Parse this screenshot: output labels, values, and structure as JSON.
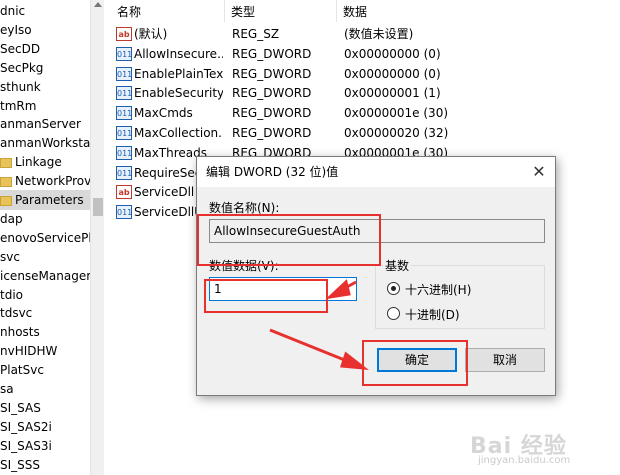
{
  "tree": {
    "items": [
      {
        "label": "dnic"
      },
      {
        "label": "eyIso"
      },
      {
        "label": "SecDD"
      },
      {
        "label": "SecPkg"
      },
      {
        "label": "sthunk"
      },
      {
        "label": "tmRm"
      },
      {
        "label": "anmanServer"
      },
      {
        "label": "anmanWorkstatio"
      },
      {
        "label": "Linkage"
      },
      {
        "label": "NetworkProvid"
      },
      {
        "label": "Parameters"
      },
      {
        "label": "dap"
      },
      {
        "label": "enovoServicePlug"
      },
      {
        "label": "svc"
      },
      {
        "label": "icenseManager"
      },
      {
        "label": "tdio"
      },
      {
        "label": "tdsvc"
      },
      {
        "label": "nhosts"
      },
      {
        "label": "nvHIDHW"
      },
      {
        "label": "PlatSvc"
      },
      {
        "label": "sa"
      },
      {
        "label": "SI_SAS"
      },
      {
        "label": "SI_SAS2i"
      },
      {
        "label": "SI_SAS3i"
      },
      {
        "label": "SI_SSS"
      }
    ]
  },
  "columns": {
    "name": "名称",
    "type": "类型",
    "data": "数据"
  },
  "rows": [
    {
      "icon": "ab",
      "name": "(默认)",
      "type": "REG_SZ",
      "data": "(数值未设置)"
    },
    {
      "icon": "dw",
      "name": "AllowInsecure...",
      "type": "REG_DWORD",
      "data": "0x00000000 (0)"
    },
    {
      "icon": "dw",
      "name": "EnablePlainTex...",
      "type": "REG_DWORD",
      "data": "0x00000000 (0)"
    },
    {
      "icon": "dw",
      "name": "EnableSecurity...",
      "type": "REG_DWORD",
      "data": "0x00000001 (1)"
    },
    {
      "icon": "dw",
      "name": "MaxCmds",
      "type": "REG_DWORD",
      "data": "0x0000001e (30)"
    },
    {
      "icon": "dw",
      "name": "MaxCollection...",
      "type": "REG_DWORD",
      "data": "0x00000020 (32)"
    },
    {
      "icon": "dw",
      "name": "MaxThreads",
      "type": "REG_DWORD",
      "data": "0x0000001e (30)"
    },
    {
      "icon": "dw",
      "name": "RequireSec",
      "type": "",
      "data": ""
    },
    {
      "icon": "ab",
      "name": "ServiceDll",
      "type": "",
      "data": ""
    },
    {
      "icon": "dw",
      "name": "ServiceDllU",
      "type": "",
      "data": ""
    }
  ],
  "dialog": {
    "title": "编辑 DWORD (32 位)值",
    "close_glyph": "✕",
    "name_label": "数值名称(N):",
    "name_value": "AllowInsecureGuestAuth",
    "data_label": "数值数据(V):",
    "data_value": "1",
    "base_label": "基数",
    "hex_label": "十六进制(H)",
    "dec_label": "十进制(D)",
    "hex_selected": true,
    "ok_label": "确定",
    "cancel_label": "取消"
  },
  "colors": {
    "annotation": "#e8312f",
    "focus": "#0078d7"
  },
  "watermark": {
    "text": "Bai 经验",
    "sub": "jingyan.baidu.com"
  }
}
